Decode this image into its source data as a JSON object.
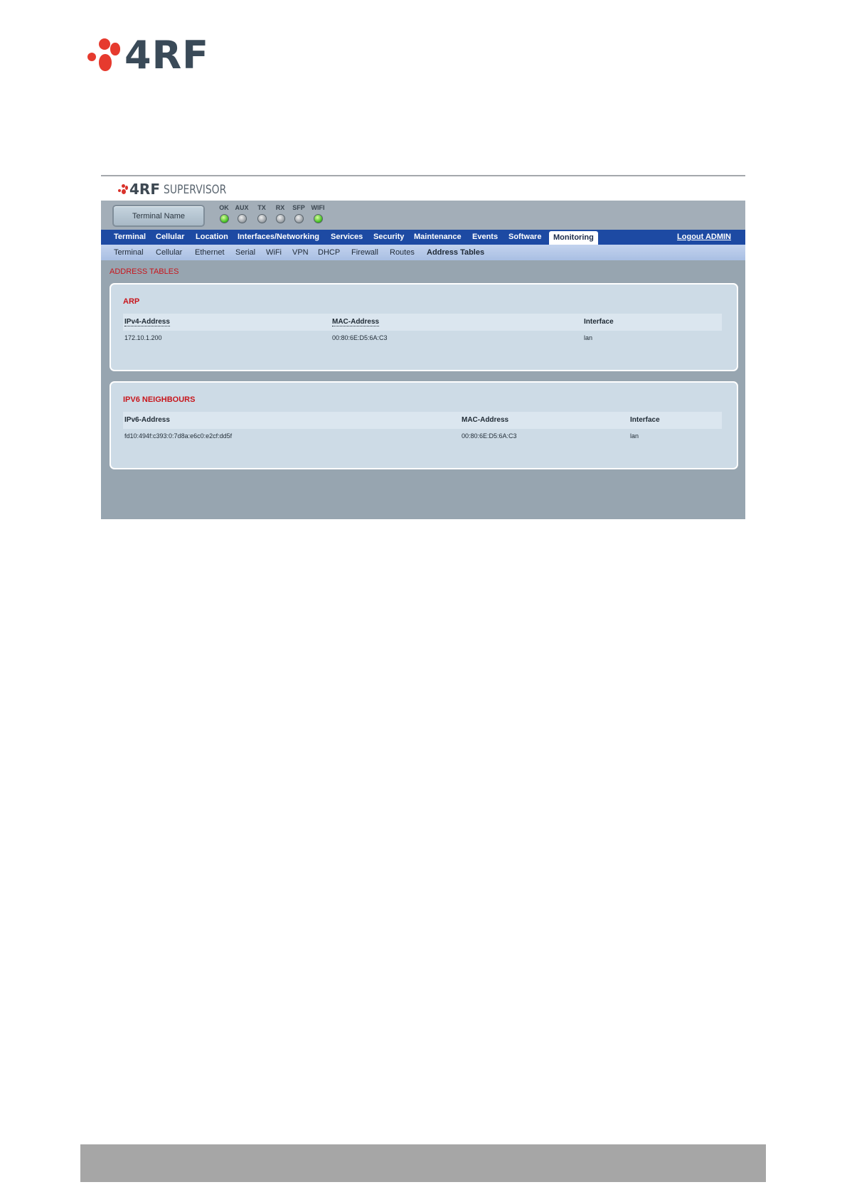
{
  "page_logo": {
    "text": "4RF"
  },
  "app": {
    "brand": "4RF",
    "product": "SUPERVISOR",
    "terminal_button": "Terminal Name"
  },
  "leds": [
    {
      "label": "OK",
      "state": "on"
    },
    {
      "label": "AUX",
      "state": "off"
    },
    {
      "label": "TX",
      "state": "off"
    },
    {
      "label": "RX",
      "state": "off"
    },
    {
      "label": "SFP",
      "state": "off"
    },
    {
      "label": "WIFI",
      "state": "on"
    }
  ],
  "nav": {
    "items": [
      "Terminal",
      "Cellular",
      "Location",
      "Interfaces/Networking",
      "Services",
      "Security",
      "Maintenance",
      "Events",
      "Software",
      "Monitoring"
    ],
    "active": "Monitoring",
    "logout": "Logout ADMIN"
  },
  "subnav": {
    "items": [
      "Terminal",
      "Cellular",
      "Ethernet",
      "Serial",
      "WiFi",
      "VPN",
      "DHCP",
      "Firewall",
      "Routes",
      "Address Tables"
    ],
    "active": "Address Tables"
  },
  "page_title": "ADDRESS TABLES",
  "arp": {
    "title": "ARP",
    "columns": [
      "IPv4-Address",
      "MAC-Address",
      "Interface"
    ],
    "rows": [
      [
        "172.10.1.200",
        "00:80:6E:D5:6A:C3",
        "lan"
      ]
    ]
  },
  "ipv6": {
    "title": "IPV6 NEIGHBOURS",
    "columns": [
      "IPv6-Address",
      "MAC-Address",
      "Interface"
    ],
    "rows": [
      [
        "fd10:494f:c393:0:7d8a:e6c0:e2cf:dd5f",
        "00:80:6E:D5:6A:C3",
        "lan"
      ]
    ]
  },
  "colors": {
    "nav_bg": "#1d4aa3",
    "accent_red": "#c8151b",
    "logo_red": "#e63a2e",
    "content_bg": "#97a5b0",
    "footer_bar": "#a6a6a6"
  }
}
